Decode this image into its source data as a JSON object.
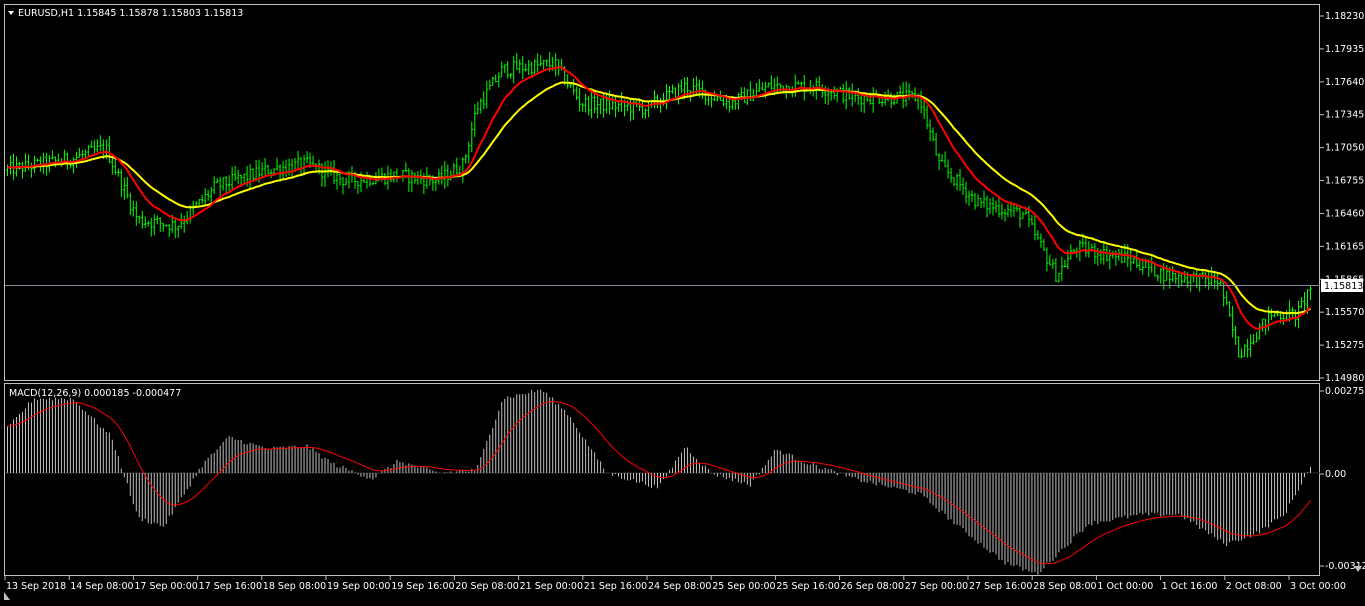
{
  "colors": {
    "background": "#000000",
    "frame": "#c0c0c0",
    "candles": "#00ff00",
    "ma_fast": "#ff0000",
    "ma_slow": "#ffff00",
    "macd_hist": "#c0c0c0",
    "macd_signal": "#ff0000",
    "text": "#ffffff",
    "bid_label_bg": "#ffffff",
    "bid_label_text": "#000000"
  },
  "main_panel": {
    "symbol_menu_icon": "triangle-down-icon",
    "header": "EURUSD,H1  1.15845 1.15878 1.15803 1.15813",
    "price_axis_labels": [
      "1.18230",
      "1.17935",
      "1.17640",
      "1.17345",
      "1.17050",
      "1.16755",
      "1.16460",
      "1.16165",
      "1.15865",
      "1.15570",
      "1.15275",
      "1.14980"
    ],
    "current_price_label": "1.15813"
  },
  "macd_panel": {
    "header": "MACD(12,26,9) 0.000185 -0.000477",
    "axis_labels": [
      "0.002752",
      "0.00",
      "-0.003124"
    ]
  },
  "time_axis_labels": [
    "13 Sep 2018",
    "14 Sep 08:00",
    "17 Sep 00:00",
    "17 Sep 16:00",
    "18 Sep 08:00",
    "19 Sep 00:00",
    "19 Sep 16:00",
    "20 Sep 08:00",
    "21 Sep 00:00",
    "21 Sep 16:00",
    "24 Sep 08:00",
    "25 Sep 00:00",
    "25 Sep 16:00",
    "26 Sep 08:00",
    "27 Sep 00:00",
    "27 Sep 16:00",
    "28 Sep 08:00",
    "1 Oct 00:00",
    "1 Oct 16:00",
    "2 Oct 08:00",
    "3 Oct 00:00"
  ],
  "chart_data": {
    "type": "line",
    "symbol": "EURUSD",
    "timeframe": "H1",
    "ylim": [
      1.1498,
      1.1823
    ],
    "price_trend_anchors": [
      [
        0,
        1.1685
      ],
      [
        0.05,
        1.1695
      ],
      [
        0.075,
        1.1705
      ],
      [
        0.1,
        1.164
      ],
      [
        0.13,
        1.1635
      ],
      [
        0.16,
        1.167
      ],
      [
        0.2,
        1.1685
      ],
      [
        0.23,
        1.169
      ],
      [
        0.26,
        1.1675
      ],
      [
        0.3,
        1.168
      ],
      [
        0.33,
        1.1675
      ],
      [
        0.35,
        1.169
      ],
      [
        0.36,
        1.174
      ],
      [
        0.38,
        1.1775
      ],
      [
        0.42,
        1.178
      ],
      [
        0.44,
        1.1745
      ],
      [
        0.49,
        1.174
      ],
      [
        0.52,
        1.176
      ],
      [
        0.555,
        1.1745
      ],
      [
        0.585,
        1.176
      ],
      [
        0.62,
        1.176
      ],
      [
        0.65,
        1.175
      ],
      [
        0.7,
        1.175
      ],
      [
        0.715,
        1.169
      ],
      [
        0.745,
        1.1655
      ],
      [
        0.78,
        1.1645
      ],
      [
        0.805,
        1.159
      ],
      [
        0.82,
        1.1615
      ],
      [
        0.86,
        1.1605
      ],
      [
        0.89,
        1.159
      ],
      [
        0.93,
        1.1585
      ],
      [
        0.945,
        1.152
      ],
      [
        0.97,
        1.1555
      ],
      [
        0.99,
        1.1555
      ],
      [
        1.0,
        1.158
      ]
    ],
    "macd_ylim": [
      -0.003124,
      0.002752
    ],
    "macd_trend_anchors": [
      [
        0,
        0.0015
      ],
      [
        0.02,
        0.0025
      ],
      [
        0.05,
        0.0025
      ],
      [
        0.08,
        0.0012
      ],
      [
        0.1,
        -0.0015
      ],
      [
        0.12,
        -0.0018
      ],
      [
        0.15,
        0.0003
      ],
      [
        0.17,
        0.0012
      ],
      [
        0.2,
        0.0008
      ],
      [
        0.23,
        0.0009
      ],
      [
        0.25,
        0.0003
      ],
      [
        0.28,
        -0.0002
      ],
      [
        0.3,
        0.0004
      ],
      [
        0.33,
        0.0
      ],
      [
        0.36,
        0.0001
      ],
      [
        0.38,
        0.0025
      ],
      [
        0.41,
        0.0028
      ],
      [
        0.43,
        0.002
      ],
      [
        0.46,
        0.0
      ],
      [
        0.5,
        -0.0005
      ],
      [
        0.52,
        0.0009
      ],
      [
        0.54,
        0.0
      ],
      [
        0.57,
        -0.0004
      ],
      [
        0.59,
        0.0008
      ],
      [
        0.61,
        0.0004
      ],
      [
        0.65,
        -0.0002
      ],
      [
        0.7,
        -0.0007
      ],
      [
        0.73,
        -0.0018
      ],
      [
        0.765,
        -0.003
      ],
      [
        0.79,
        -0.0034
      ],
      [
        0.83,
        -0.0017
      ],
      [
        0.87,
        -0.0014
      ],
      [
        0.9,
        -0.0014
      ],
      [
        0.935,
        -0.0024
      ],
      [
        0.96,
        -0.002
      ],
      [
        0.98,
        -0.0014
      ],
      [
        1.0,
        0.0002
      ]
    ]
  }
}
